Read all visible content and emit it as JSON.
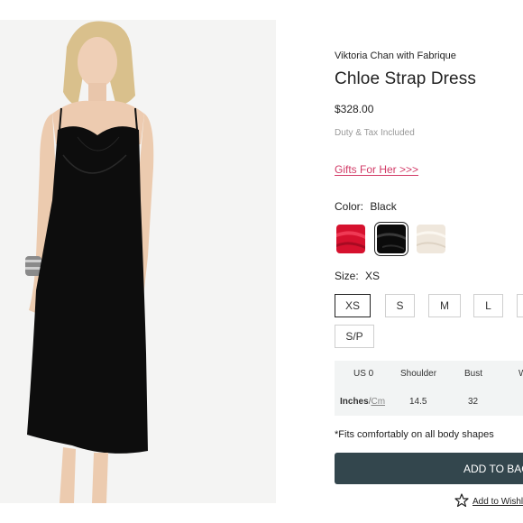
{
  "product": {
    "brand": "Viktoria Chan with Fabrique",
    "title": "Chloe Strap Dress",
    "price": "$328.00",
    "duty_note": "Duty & Tax Included",
    "gifts_link": "Gifts For Her >>>"
  },
  "color": {
    "label": "Color:",
    "selected": "Black",
    "swatches": [
      {
        "name": "Red",
        "hex": "#d6112e"
      },
      {
        "name": "Black",
        "hex": "#0b0b0b"
      },
      {
        "name": "Cream",
        "hex": "#efe7dc"
      }
    ]
  },
  "size": {
    "label": "Size:",
    "selected": "XS",
    "options": [
      "XS",
      "S",
      "M",
      "L",
      "",
      "S/P"
    ]
  },
  "size_table": {
    "headers": [
      "US 0",
      "Shoulder",
      "Bust",
      "W"
    ],
    "unit_inches": "Inches",
    "unit_separator": "/",
    "unit_cm": "Cm",
    "values": [
      "14.5",
      "32"
    ]
  },
  "fit_note": "*Fits comfortably on all body shapes",
  "actions": {
    "add_to_bag": "ADD TO BAG",
    "wishlist": "Add to Wishl"
  }
}
